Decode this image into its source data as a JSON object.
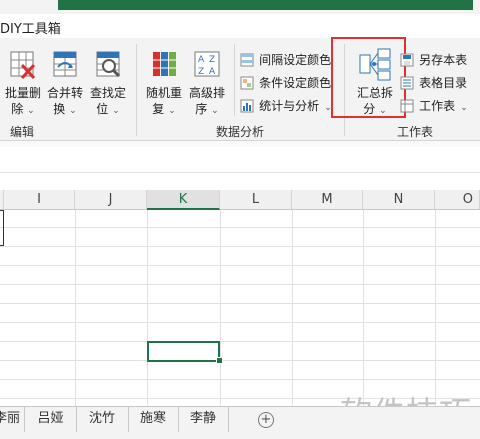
{
  "ribbon_tab_title": "DIY工具箱",
  "groups": [
    {
      "label": "编辑",
      "buttons": [
        {
          "line1": "批量删",
          "line2": "除"
        },
        {
          "line1": "合并转",
          "line2": "换"
        },
        {
          "line1": "查找定",
          "line2": "位"
        }
      ]
    },
    {
      "label": "数据分析",
      "buttons": [
        {
          "line1": "随机重",
          "line2": "复"
        },
        {
          "line1": "高级排",
          "line2": "序"
        }
      ],
      "small_buttons": [
        "间隔设定颜色",
        "条件设定颜色",
        "统计与分析"
      ]
    },
    {
      "label": "工作表",
      "buttons": [
        {
          "line1": "汇总拆",
          "line2": "分"
        }
      ],
      "small_buttons": [
        "另存本表",
        "表格目录",
        "工作表"
      ]
    }
  ],
  "columns": [
    "I",
    "J",
    "K",
    "L",
    "M",
    "N",
    "O"
  ],
  "active_column": "K",
  "sheet_tabs": [
    "李丽",
    "吕娅",
    "沈竹",
    "施寒",
    "李静"
  ],
  "add_sheet_symbol": "+",
  "watermark": "软件技巧",
  "accent_color": "#217346",
  "highlight_color": "#e0312f"
}
